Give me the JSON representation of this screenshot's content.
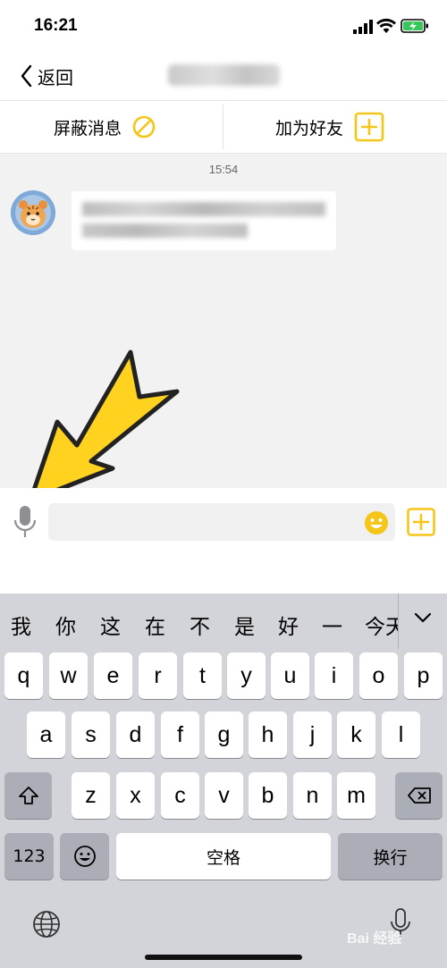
{
  "status_bar": {
    "time": "16:21"
  },
  "nav": {
    "back_label": "返回"
  },
  "actions": {
    "block_label": "屏蔽消息",
    "add_friend_label": "加为好友"
  },
  "chat": {
    "timestamp": "15:54"
  },
  "input": {
    "value": "",
    "placeholder": ""
  },
  "keyboard": {
    "candidates": [
      "我",
      "你",
      "这",
      "在",
      "不",
      "是",
      "好",
      "一",
      "今天"
    ],
    "row1": [
      "q",
      "w",
      "e",
      "r",
      "t",
      "y",
      "u",
      "i",
      "o",
      "p"
    ],
    "row2": [
      "a",
      "s",
      "d",
      "f",
      "g",
      "h",
      "j",
      "k",
      "l"
    ],
    "row3": [
      "z",
      "x",
      "c",
      "v",
      "b",
      "n",
      "m"
    ],
    "numbers_label": "123",
    "space_label": "空格",
    "return_label": "换行"
  },
  "watermark": {
    "text": "Bai 经验"
  },
  "colors": {
    "accent": "#f5c518",
    "arrow": "#ffd21f",
    "icon_gray": "#8e8e93"
  }
}
